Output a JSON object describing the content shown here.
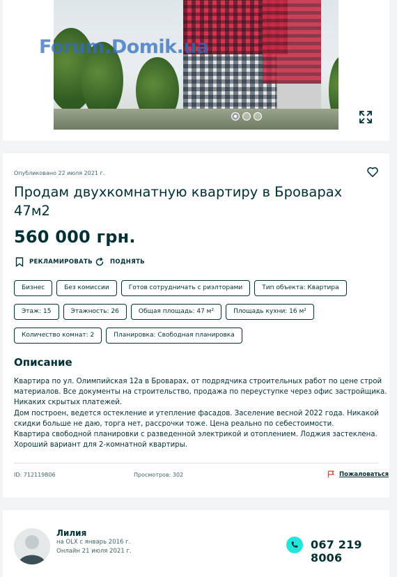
{
  "gallery": {
    "watermark": "Forum.Domik.ua",
    "slides": 3,
    "active_slide": 1,
    "expand_icon": "expand-icon"
  },
  "ad": {
    "published": "Опубликовано 22 июля 2021 г.",
    "title": "Продам двухкомнатную квартиру в Броварах 47м2",
    "price": "560 000 грн.",
    "actions": {
      "promote": "РЕКЛАМИРОВАТЬ",
      "raise": "ПОДНЯТЬ"
    },
    "tag_rows": [
      [
        "Бизнес",
        "Без комиссии",
        "Готов сотрудничать с риэлторами",
        "Тип объекта: Квартира"
      ],
      [
        "Этаж: 15",
        "Этажность: 26",
        "Общая площадь: 47 м²",
        "Площадь кухни: 16 м²"
      ],
      [
        "Количество комнат: 2",
        "Планировка: Свободная планировка"
      ]
    ],
    "description_heading": "Описание",
    "description_lines": [
      "Квартира по ул. Олимпийская 12а в Броварах, от подрядчика строительных работ по цене строй",
      "материалов. Все документы на строительство, продажа по переуступке через офис застройщика.",
      "Никаких скрытых платежей.",
      "Дом построен, ведется остекление и утепление фасадов. Заселение весной 2022 года. Никакой",
      "скидки больше не даю, торга нет, рассрочки тоже. Цена реально по себестоимости.",
      "Квартира свободной планировки с разведенной электрикой и отоплением. Лоджия застеклена.",
      "Хороший вариант для 2-комнатной квартиры."
    ],
    "id_text": "ID: 712119806",
    "views_text": "Просмотров: 302",
    "report_label": "Пожаловаться"
  },
  "seller": {
    "name": "Лилия",
    "since": "на OLX с январь 2016 г.",
    "online": "Онлайн 21 июля 2021 г.",
    "phone": "067 219 8006"
  },
  "colors": {
    "text": "#002f34",
    "muted": "#406367",
    "accent": "#23e5db",
    "background": "#f2f4f5",
    "report_flag": "#e0443b"
  }
}
